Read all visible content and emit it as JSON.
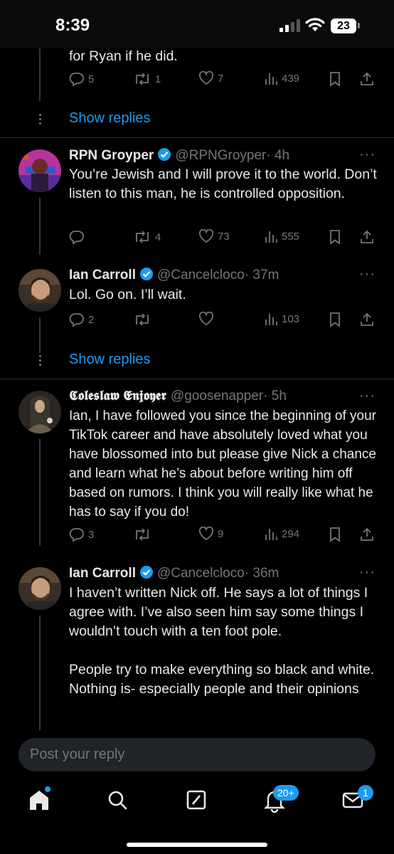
{
  "status_bar": {
    "time": "8:39",
    "battery": "23"
  },
  "previous_tweet": {
    "text_tail": "for Ryan if he did.",
    "replies": "5",
    "retweets": "1",
    "likes": "7",
    "views": "439"
  },
  "show_replies_label": "Show replies",
  "tweets": [
    {
      "name": "RPN Groyper",
      "handle": "@RPNGroyper",
      "time": "· 4h",
      "text": "You’re Jewish and I will prove it to the world. Don’t listen to this man, he is controlled opposition.",
      "replies": "",
      "retweets": "4",
      "likes": "73",
      "views": "555"
    },
    {
      "name": "Ian Carroll",
      "handle": "@Cancelcloco",
      "time": "· 37m",
      "text": "Lol. Go on. I’ll wait.",
      "replies": "2",
      "retweets": "",
      "likes": "",
      "views": "103"
    },
    {
      "name": "𝕮𝖔𝖑𝖊𝖘𝖑𝖆𝖜 𝕰𝖓𝖏𝖔𝖞𝖊𝖗",
      "handle": "@goosenapper",
      "time": "· 5h",
      "text": "Ian, I have followed you since the beginning of your TikTok career and have absolutely loved what you have blossomed into but please give Nick a chance and learn what he’s about before writing him off based on rumors. I think you will really like what he has to say if you do!",
      "replies": "3",
      "retweets": "",
      "likes": "9",
      "views": "294"
    },
    {
      "name": "Ian Carroll",
      "handle": "@Cancelcloco",
      "time": "· 36m",
      "text": "I haven’t written Nick off. He says a lot of things I agree with. I’ve also seen him say some things I wouldn’t touch with a ten foot pole.\n\nPeople try to make everything so black and white. Nothing is- especially people and their opinions"
    }
  ],
  "reply_placeholder": "Post your reply",
  "tab_bar": {
    "notifications_badge": "20+",
    "messages_badge": "1"
  },
  "colors": {
    "accent": "#1d9bf0",
    "background": "#000000",
    "muted": "#71767b"
  }
}
